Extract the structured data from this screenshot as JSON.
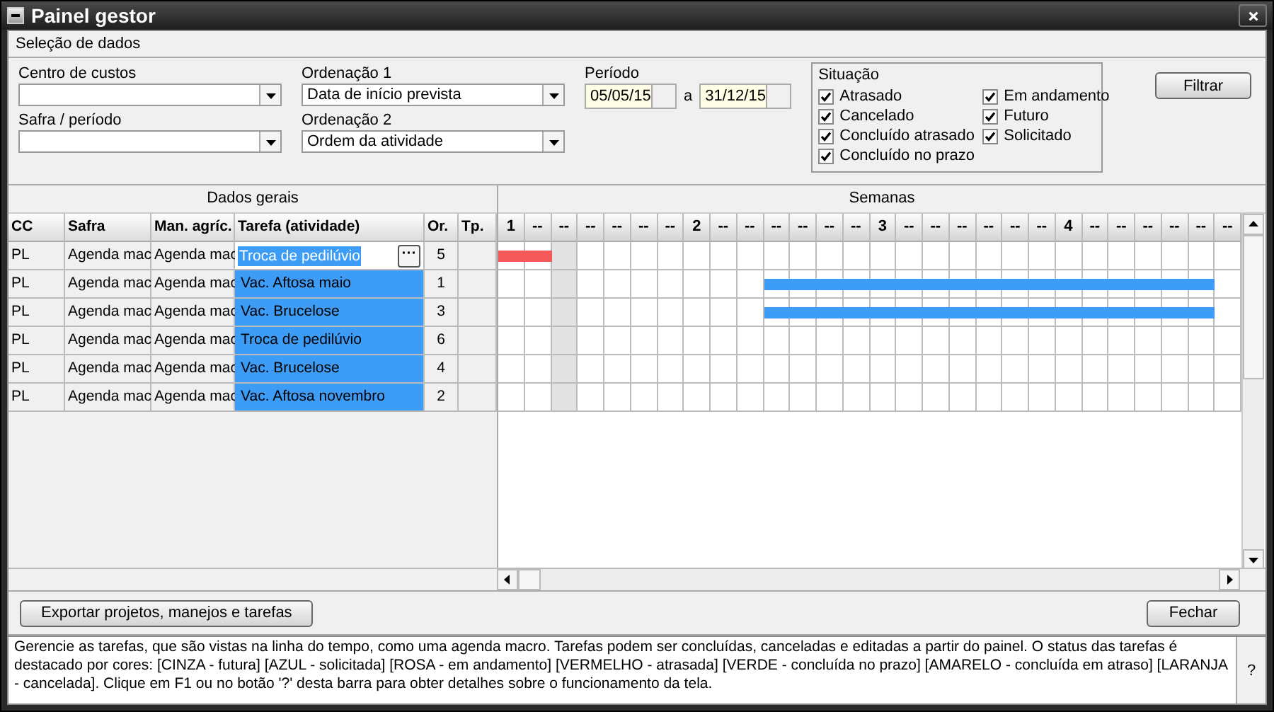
{
  "window": {
    "title": "Painel gestor"
  },
  "section_title": "Seleção de dados",
  "filters": {
    "cost_center": {
      "label": "Centro de custos"
    },
    "season": {
      "label": "Safra / período"
    },
    "order1": {
      "label": "Ordenação 1",
      "value": "Data de início prevista"
    },
    "order2": {
      "label": "Ordenação 2",
      "value": "Ordem da atividade"
    },
    "period": {
      "label": "Período",
      "from": "05/05/15",
      "separator": "a",
      "to": "31/12/15"
    },
    "status": {
      "title": "Situação",
      "options": [
        {
          "label": "Atrasado",
          "checked": true
        },
        {
          "label": "Cancelado",
          "checked": true
        },
        {
          "label": "Concluído atrasado",
          "checked": true
        },
        {
          "label": "Concluído no prazo",
          "checked": true
        },
        {
          "label": "Em andamento",
          "checked": true
        },
        {
          "label": "Futuro",
          "checked": true
        },
        {
          "label": "Solicitado",
          "checked": true
        }
      ]
    },
    "filter_button": "Filtrar"
  },
  "table": {
    "group_general": "Dados gerais",
    "group_weeks": "Semanas",
    "columns": [
      "CC",
      "Safra",
      "Man. agríc.",
      "Tarefa (atividade)",
      "Or.",
      "Tp."
    ],
    "weeks": [
      {
        "label": "1",
        "shaded": false
      },
      {
        "label": "--",
        "shaded": false
      },
      {
        "label": "--",
        "shaded": true
      },
      {
        "label": "--",
        "shaded": false
      },
      {
        "label": "--",
        "shaded": false
      },
      {
        "label": "--",
        "shaded": false
      },
      {
        "label": "--",
        "shaded": false
      },
      {
        "label": "2",
        "shaded": false
      },
      {
        "label": "--",
        "shaded": false
      },
      {
        "label": "--",
        "shaded": false
      },
      {
        "label": "--",
        "shaded": false
      },
      {
        "label": "--",
        "shaded": false
      },
      {
        "label": "--",
        "shaded": false
      },
      {
        "label": "--",
        "shaded": false
      },
      {
        "label": "3",
        "shaded": false
      },
      {
        "label": "--",
        "shaded": false
      },
      {
        "label": "--",
        "shaded": false
      },
      {
        "label": "--",
        "shaded": false
      },
      {
        "label": "--",
        "shaded": false
      },
      {
        "label": "--",
        "shaded": false
      },
      {
        "label": "--",
        "shaded": false
      },
      {
        "label": "4",
        "shaded": false
      },
      {
        "label": "--",
        "shaded": false
      },
      {
        "label": "--",
        "shaded": false
      },
      {
        "label": "--",
        "shaded": false
      },
      {
        "label": "--",
        "shaded": false
      },
      {
        "label": "--",
        "shaded": false
      },
      {
        "label": "--",
        "shaded": false
      }
    ],
    "rows": [
      {
        "cc": "PL",
        "safra": "Agenda mac",
        "man": "Agenda mac",
        "task": "Troca de pedilúvio",
        "editing": true,
        "action_label": "···",
        "color": "#3c9cf6",
        "order": "5",
        "bar": {
          "color": "#f55a5a",
          "weeks": [
            true,
            true,
            false,
            false,
            false,
            false,
            false,
            false,
            false,
            false,
            false,
            false,
            false,
            false,
            false,
            false,
            false,
            false,
            false,
            false,
            false,
            false,
            false,
            false,
            false,
            false,
            false,
            false
          ]
        }
      },
      {
        "cc": "PL",
        "safra": "Agenda mac",
        "man": "Agenda mac",
        "task": "Vac. Aftosa maio",
        "editing": false,
        "color": "#3c9cf6",
        "order": "1",
        "bar": {
          "color": "#3c9cf6",
          "weeks": [
            false,
            false,
            false,
            false,
            false,
            false,
            false,
            false,
            false,
            false,
            true,
            true,
            true,
            true,
            true,
            true,
            true,
            true,
            true,
            true,
            true,
            true,
            true,
            true,
            true,
            true,
            true,
            false
          ]
        }
      },
      {
        "cc": "PL",
        "safra": "Agenda mac",
        "man": "Agenda mac",
        "task": "Vac. Brucelose",
        "editing": false,
        "color": "#3c9cf6",
        "order": "3",
        "bar": {
          "color": "#3c9cf6",
          "weeks": [
            false,
            false,
            false,
            false,
            false,
            false,
            false,
            false,
            false,
            false,
            true,
            true,
            true,
            true,
            true,
            true,
            true,
            true,
            true,
            true,
            true,
            true,
            true,
            true,
            true,
            true,
            true,
            false
          ]
        }
      },
      {
        "cc": "PL",
        "safra": "Agenda mac",
        "man": "Agenda mac",
        "task": "Troca de pedilúvio",
        "editing": false,
        "color": "#3c9cf6",
        "order": "6"
      },
      {
        "cc": "PL",
        "safra": "Agenda mac",
        "man": "Agenda mac",
        "task": "Vac. Brucelose",
        "editing": false,
        "color": "#3c9cf6",
        "order": "4"
      },
      {
        "cc": "PL",
        "safra": "Agenda mac",
        "man": "Agenda mac",
        "task": "Vac. Aftosa novembro",
        "editing": false,
        "color": "#3c9cf6",
        "order": "2"
      }
    ]
  },
  "export_button": "Exportar projetos, manejos e tarefas",
  "close_button": "Fechar",
  "help_text": "Gerencie as tarefas, que são vistas na linha do tempo, como uma agenda macro. Tarefas podem ser concluídas, canceladas e editadas a partir do painel. O status das tarefas é destacado por cores: [CINZA - futura] [AZUL - solicitada] [ROSA - em andamento] [VERMELHO - atrasada] [VERDE - concluída no prazo] [AMARELO - concluída em atraso] [LARANJA - cancelada]. Clique em F1 ou no botão '?' desta barra para obter detalhes sobre o funcionamento da tela.",
  "help_button": "?"
}
